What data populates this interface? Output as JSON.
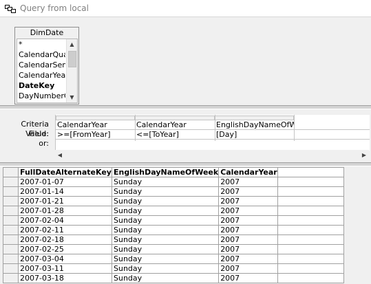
{
  "window": {
    "title": "Query from local"
  },
  "diagram": {
    "table_name": "DimDate",
    "fields": [
      "*",
      "CalendarQuarter",
      "CalendarSemester",
      "CalendarYear",
      "DateKey",
      "DayNumberOfWeek"
    ],
    "bold_field": "DateKey"
  },
  "criteria": {
    "labels": {
      "field": "Criteria Field:",
      "value": "Value:",
      "or": "or:"
    },
    "columns": [
      {
        "field": "CalendarYear",
        "value": ">=[FromYear]"
      },
      {
        "field": "CalendarYear",
        "value": "<=[ToYear]"
      },
      {
        "field": "EnglishDayNameOfWeek",
        "value": "[Day]"
      }
    ]
  },
  "results": {
    "columns": [
      "FullDateAlternateKey",
      "EnglishDayNameOfWeek",
      "CalendarYear"
    ],
    "rows": [
      [
        "2007-01-07",
        "Sunday",
        "2007"
      ],
      [
        "2007-01-14",
        "Sunday",
        "2007"
      ],
      [
        "2007-01-21",
        "Sunday",
        "2007"
      ],
      [
        "2007-01-28",
        "Sunday",
        "2007"
      ],
      [
        "2007-02-04",
        "Sunday",
        "2007"
      ],
      [
        "2007-02-11",
        "Sunday",
        "2007"
      ],
      [
        "2007-02-18",
        "Sunday",
        "2007"
      ],
      [
        "2007-02-25",
        "Sunday",
        "2007"
      ],
      [
        "2007-03-04",
        "Sunday",
        "2007"
      ],
      [
        "2007-03-11",
        "Sunday",
        "2007"
      ],
      [
        "2007-03-18",
        "Sunday",
        "2007"
      ]
    ]
  },
  "icons": {
    "window": "query-icon",
    "scroll_up": "chevron-up-icon",
    "scroll_down": "chevron-down-icon",
    "scroll_left": "chevron-left-icon",
    "scroll_right": "chevron-right-icon"
  }
}
